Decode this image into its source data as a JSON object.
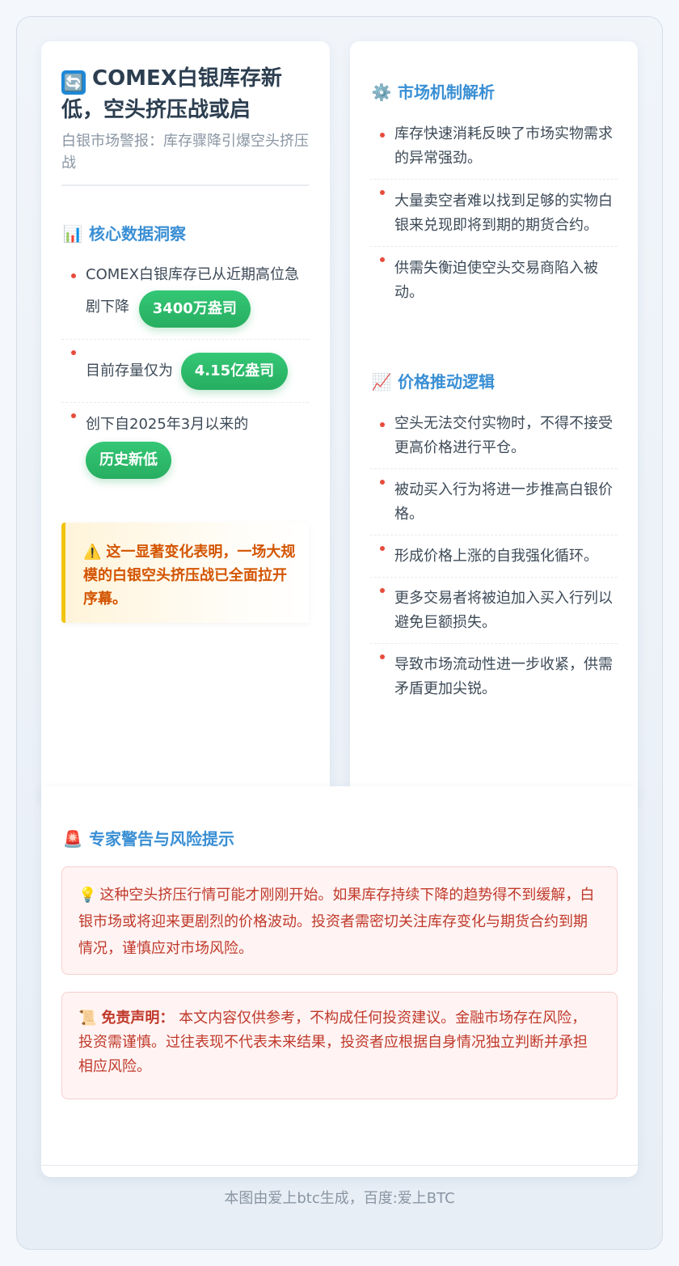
{
  "header": {
    "title_icon": "🔄",
    "title": "COMEX白银库存新低，空头挤压战或启",
    "subtitle": "白银市场警报：库存骤降引爆空头挤压战"
  },
  "core_data": {
    "heading_icon": "📊",
    "heading": "核心数据洞察",
    "items": [
      {
        "text": "COMEX白银库存已从近期高位急剧下降",
        "badge": "3400万盎司"
      },
      {
        "text": "目前存量仅为",
        "badge": "4.15亿盎司"
      },
      {
        "text": "创下自2025年3月以来的",
        "badge": "历史新低"
      }
    ]
  },
  "callout": {
    "icon": "⚠️",
    "text": "这一显著变化表明，一场大规模的白银空头挤压战已全面拉开序幕。"
  },
  "mechanism": {
    "heading_icon": "⚙️",
    "heading": "市场机制解析",
    "items": [
      "库存快速消耗反映了市场实物需求的异常强劲。",
      "大量卖空者难以找到足够的实物白银来兑现即将到期的期货合约。",
      "供需失衡迫使空头交易商陷入被动。"
    ]
  },
  "price_logic": {
    "heading_icon": "📈",
    "heading": "价格推动逻辑",
    "items": [
      "空头无法交付实物时，不得不接受更高价格进行平仓。",
      "被动买入行为将进一步推高白银价格。",
      "形成价格上涨的自我强化循环。",
      "更多交易者将被迫加入买入行列以避免巨额损失。",
      "导致市场流动性进一步收紧，供需矛盾更加尖锐。"
    ]
  },
  "warning": {
    "heading_icon": "🚨",
    "heading": "专家警告与风险提示",
    "tip_icon": "💡",
    "tip": "这种空头挤压行情可能才刚刚开始。如果库存持续下降的趋势得不到缓解，白银市场或将迎来更剧烈的价格波动。投资者需密切关注库存变化与期货合约到期情况，谨慎应对市场风险。",
    "disclaimer_icon": "📜",
    "disclaimer_label": "免责声明：",
    "disclaimer": "本文内容仅供参考，不构成任何投资建议。金融市场存在风险，投资需谨慎。过往表现不代表未来结果，投资者应根据自身情况独立判断并承担相应风险。"
  },
  "footer": {
    "text": "本图由爱上btc生成，百度:爱上BTC"
  },
  "colors": {
    "accent_blue": "#3a8fd4",
    "badge_green": "#27ae60",
    "bullet_red": "#e74c3c",
    "callout_orange": "#d35400",
    "alert_red": "#c0392b"
  }
}
